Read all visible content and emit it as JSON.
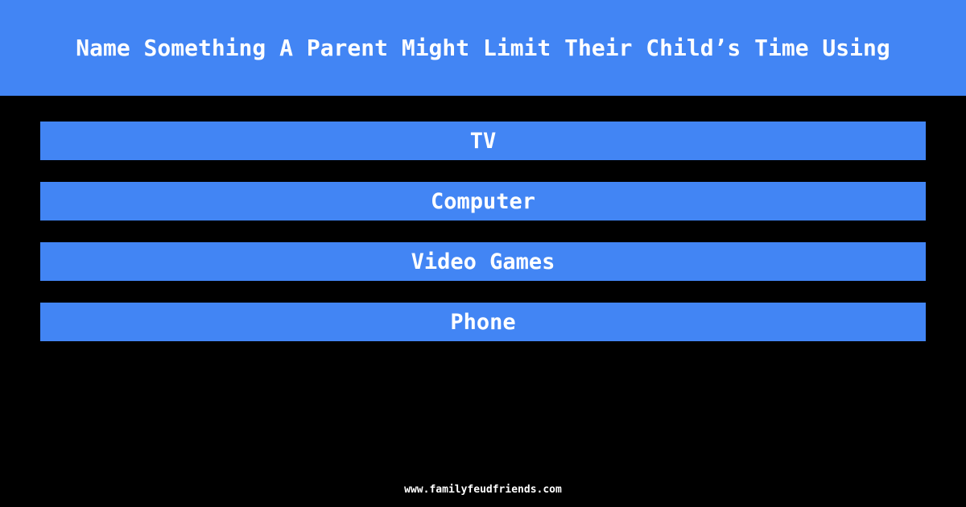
{
  "header": {
    "question": "Name Something A Parent Might Limit Their Child’s Time Using",
    "background_color": "#4285f4",
    "text_color": "#ffffff"
  },
  "board": {
    "background_color": "#000000",
    "answer_bar_color": "#4285f4",
    "answer_text_color": "#ffffff",
    "answers": [
      {
        "rank": 1,
        "text": "TV"
      },
      {
        "rank": 2,
        "text": "Computer"
      },
      {
        "rank": 3,
        "text": "Video Games"
      },
      {
        "rank": 4,
        "text": "Phone"
      }
    ]
  },
  "footer": {
    "url": "www.familyfeudfriends.com",
    "text_color": "#ffffff"
  }
}
